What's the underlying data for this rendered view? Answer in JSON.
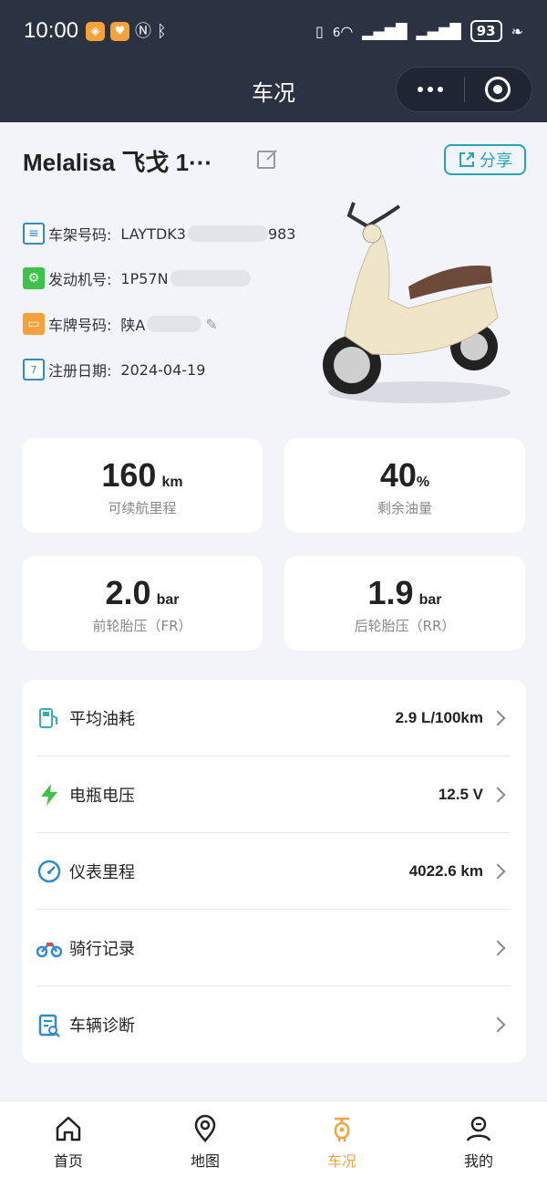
{
  "status_bar": {
    "time": "10:00",
    "battery": "93",
    "network_label": "6"
  },
  "header": {
    "title": "车况"
  },
  "vehicle": {
    "name": "Melalisa 飞戈 1···",
    "share_label": "分享",
    "frame_label": "车架号码:",
    "frame_value_start": "LAYTDK3",
    "frame_value_end": "983",
    "engine_label": "发动机号:",
    "engine_value_start": "1P57N",
    "plate_label": "车牌号码:",
    "plate_value_start": "陕A",
    "reg_label": "注册日期:",
    "reg_value": "2024-04-19"
  },
  "stats": [
    {
      "value": "160",
      "unit": "km",
      "caption": "可续航里程"
    },
    {
      "value": "40",
      "unit": "%",
      "caption": "剩余油量"
    },
    {
      "value": "2.0",
      "unit": "bar",
      "caption": "前轮胎压（FR）"
    },
    {
      "value": "1.9",
      "unit": "bar",
      "caption": "后轮胎压（RR）"
    }
  ],
  "list": [
    {
      "label": "平均油耗",
      "value": "2.9 L/100km",
      "icon": "fuel-pump-icon"
    },
    {
      "label": "电瓶电压",
      "value": "12.5 V",
      "icon": "lightning-icon"
    },
    {
      "label": "仪表里程",
      "value": "4022.6 km",
      "icon": "speedometer-icon"
    },
    {
      "label": "骑行记录",
      "value": "",
      "icon": "motorcycle-icon"
    },
    {
      "label": "车辆诊断",
      "value": "",
      "icon": "diagnosis-icon"
    }
  ],
  "nav": [
    {
      "label": "首页",
      "icon": "home-icon"
    },
    {
      "label": "地图",
      "icon": "map-pin-icon"
    },
    {
      "label": "车况",
      "icon": "scooter-icon"
    },
    {
      "label": "我的",
      "icon": "profile-icon"
    }
  ],
  "colors": {
    "topbar": "#2b3242",
    "accent": "#f6a23a",
    "share": "#23a6b6",
    "background": "#f2f4f9"
  }
}
